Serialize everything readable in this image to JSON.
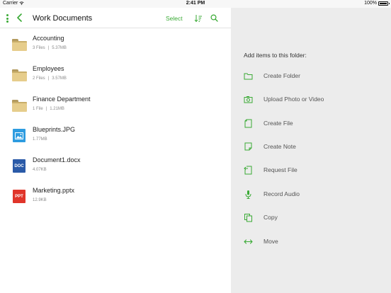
{
  "status_bar": {
    "carrier": "Carrier",
    "time": "2:41 PM",
    "battery": "100%"
  },
  "nav": {
    "title": "Work Documents",
    "select_label": "Select",
    "icons": [
      "more-dots-icon",
      "back-chevron-icon",
      "sort-icon",
      "search-icon"
    ]
  },
  "files": [
    {
      "name": "Accounting",
      "count": "3 Files",
      "size": "5.37MB",
      "type": "folder"
    },
    {
      "name": "Employees",
      "count": "2 Files",
      "size": "3.57MB",
      "type": "folder"
    },
    {
      "name": "Finance Department",
      "count": "1 File",
      "size": "1.21MB",
      "type": "folder"
    },
    {
      "name": "Blueprints.JPG",
      "size": "1.77MB",
      "type": "image"
    },
    {
      "name": "Document1.docx",
      "size": "4.07KB",
      "type": "doc",
      "badge": "DOC"
    },
    {
      "name": "Marketing.pptx",
      "size": "12.9KB",
      "type": "ppt",
      "badge": "PPT"
    }
  ],
  "sidebar": {
    "heading": "Add items to this folder:",
    "actions": [
      {
        "label": "Create Folder",
        "icon": "folder-icon"
      },
      {
        "label": "Upload Photo or Video",
        "icon": "camera-icon"
      },
      {
        "label": "Create File",
        "icon": "file-icon"
      },
      {
        "label": "Create Note",
        "icon": "note-icon"
      },
      {
        "label": "Request File",
        "icon": "request-file-icon"
      },
      {
        "label": "Record Audio",
        "icon": "microphone-icon"
      },
      {
        "label": "Copy",
        "icon": "copy-icon"
      },
      {
        "label": "Move",
        "icon": "move-arrows-icon"
      }
    ]
  },
  "colors": {
    "accent": "#3aaa35",
    "right_pane_bg": "#ececec",
    "folder": "#e6cd8c",
    "image_badge": "#2e9ce0",
    "doc_badge": "#2a5aa8",
    "ppt_badge": "#e0352a"
  }
}
